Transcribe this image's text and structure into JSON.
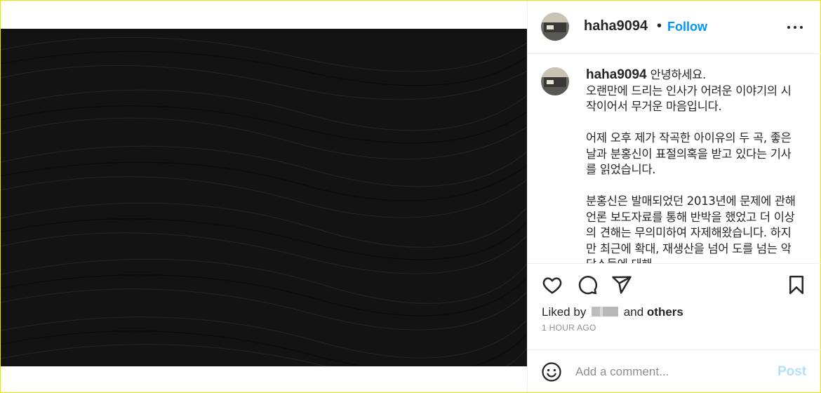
{
  "post": {
    "username": "haha9094",
    "follow_label": "Follow",
    "caption_username": "haha9094",
    "caption_text": " 안녕하세요.\n오랜만에 드리는 인사가 어려운 이야기의 시작이어서 무거운 마음입니다.\n\n어제 오후 제가 작곡한 아이유의 두 곡, 좋은 날과 분홍신이 표절의혹을 받고 있다는 기사를 읽었습니다.\n\n분홍신은 발매되었던 2013년에 문제에 관해 언론 보도자료를 통해 반박을 했었고 더 이상의 견해는 무의미하여 자제해왔습니다. 하지만 최근에 확대, 재생산을 넘어 도를 넘는 악담스들에 대해",
    "liked_prefix": "Liked by",
    "liked_and": "and",
    "liked_others": "others",
    "time": "1 HOUR AGO"
  },
  "comment": {
    "placeholder": "Add a comment...",
    "post_label": "Post"
  },
  "icons": {
    "more": "more-horizontal-icon",
    "like": "heart-icon",
    "comment": "comment-bubble-icon",
    "share": "paper-plane-icon",
    "save": "bookmark-icon",
    "emoji": "smiley-icon"
  },
  "colors": {
    "accent": "#0095f6",
    "post_disabled": "#b2dffc",
    "media_bg": "#121212",
    "muted": "#8e8e8e"
  }
}
